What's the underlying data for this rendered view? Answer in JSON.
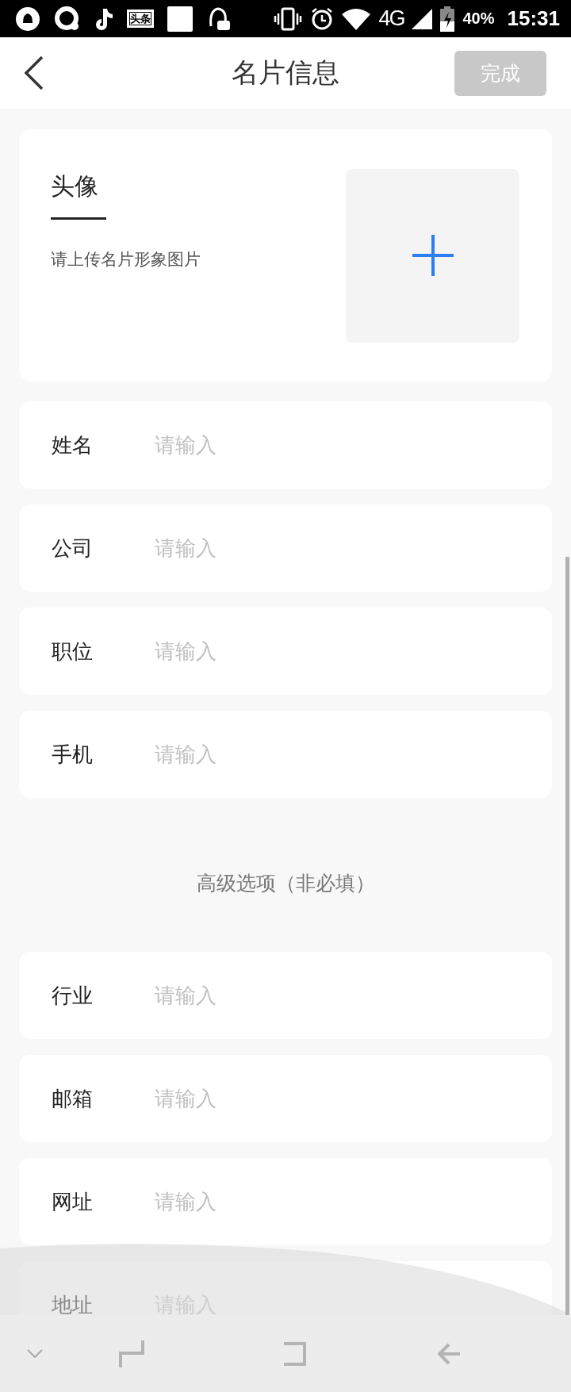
{
  "status_bar": {
    "news_app_label": "头条",
    "network": "4G",
    "battery": "40%",
    "time": "15:31"
  },
  "header": {
    "title": "名片信息",
    "done_button": {
      "label": "完成",
      "disabled": true
    }
  },
  "avatar": {
    "title": "头像",
    "hint": "请上传名片形象图片"
  },
  "fields": [
    {
      "label": "姓名",
      "placeholder": "请输入"
    },
    {
      "label": "公司",
      "placeholder": "请输入"
    },
    {
      "label": "职位",
      "placeholder": "请输入"
    },
    {
      "label": "手机",
      "placeholder": "请输入"
    }
  ],
  "advanced": {
    "title": "高级选项（非必填）",
    "fields": [
      {
        "label": "行业",
        "placeholder": "请输入"
      },
      {
        "label": "邮箱",
        "placeholder": "请输入"
      },
      {
        "label": "网址",
        "placeholder": "请输入"
      },
      {
        "label": "地址",
        "placeholder": "请输入"
      }
    ]
  }
}
